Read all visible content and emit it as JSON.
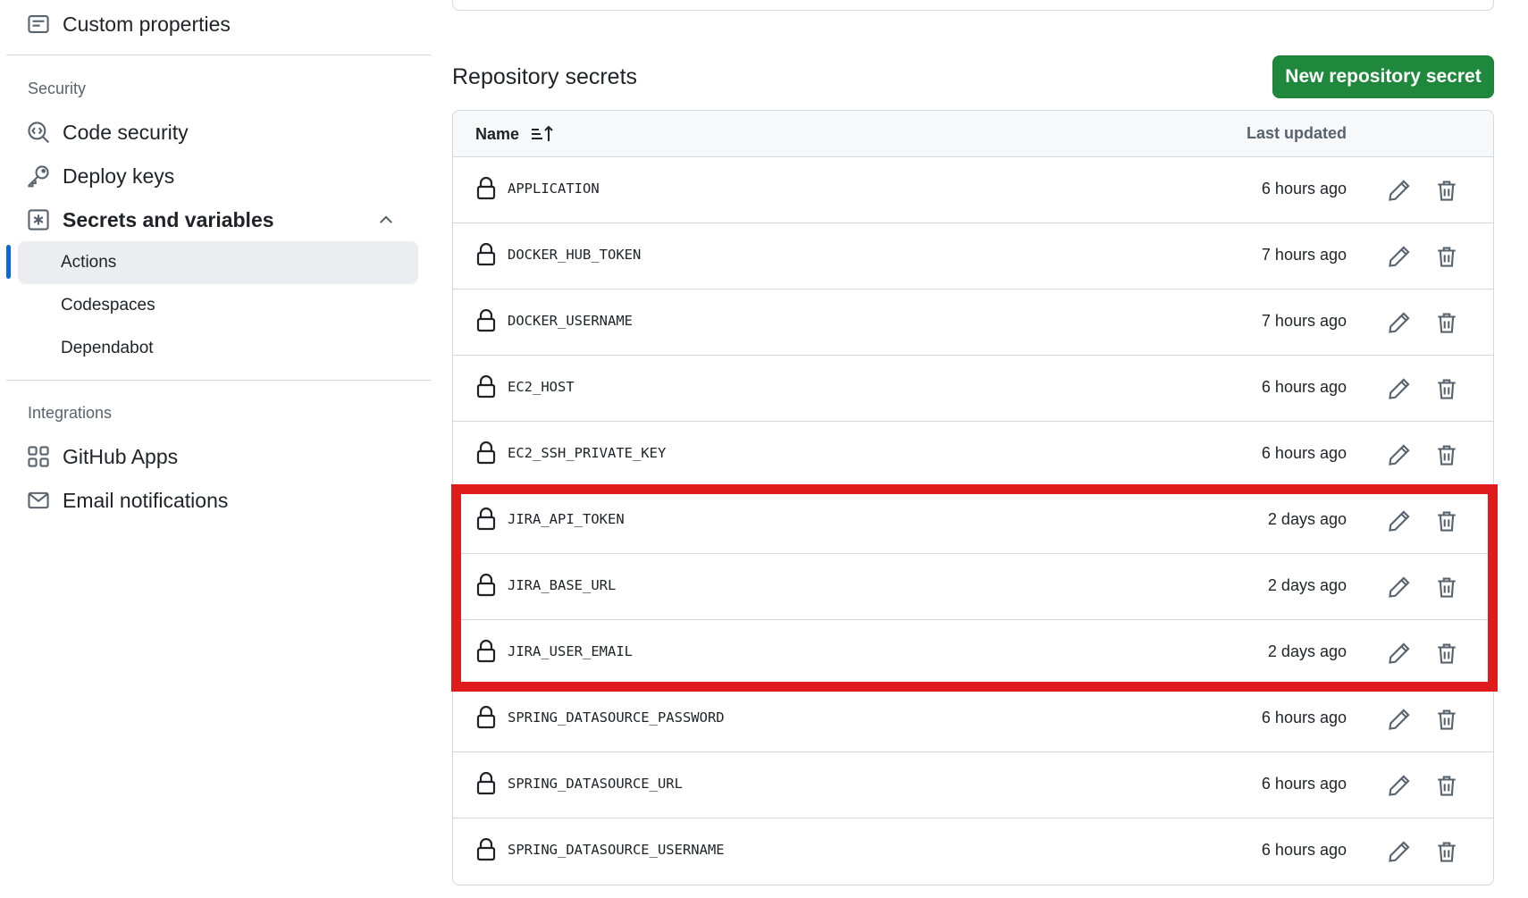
{
  "sidebar": {
    "custom_properties": "Custom properties",
    "security_heading": "Security",
    "code_security": "Code security",
    "deploy_keys": "Deploy keys",
    "secrets_and_variables": "Secrets and variables",
    "sub_items": [
      "Actions",
      "Codespaces",
      "Dependabot"
    ],
    "integrations_heading": "Integrations",
    "github_apps": "GitHub Apps",
    "email_notifications": "Email notifications",
    "active_accent": "#0969da"
  },
  "main": {
    "title": "Repository secrets",
    "new_button": "New repository secret",
    "new_button_color": "#1f883d",
    "table": {
      "col_name": "Name",
      "col_updated": "Last updated",
      "rows": [
        {
          "name": "APPLICATION",
          "updated": "6 hours ago"
        },
        {
          "name": "DOCKER_HUB_TOKEN",
          "updated": "7 hours ago"
        },
        {
          "name": "DOCKER_USERNAME",
          "updated": "7 hours ago"
        },
        {
          "name": "EC2_HOST",
          "updated": "6 hours ago"
        },
        {
          "name": "EC2_SSH_PRIVATE_KEY",
          "updated": "6 hours ago"
        },
        {
          "name": "JIRA_API_TOKEN",
          "updated": "2 days ago"
        },
        {
          "name": "JIRA_BASE_URL",
          "updated": "2 days ago"
        },
        {
          "name": "JIRA_USER_EMAIL",
          "updated": "2 days ago"
        },
        {
          "name": "SPRING_DATASOURCE_PASSWORD",
          "updated": "6 hours ago"
        },
        {
          "name": "SPRING_DATASOURCE_URL",
          "updated": "6 hours ago"
        },
        {
          "name": "SPRING_DATASOURCE_USERNAME",
          "updated": "6 hours ago"
        }
      ]
    },
    "highlight_color": "#e01b1b"
  },
  "icons": [
    "note-icon",
    "codescan-icon",
    "key-icon",
    "key-asterisk-icon",
    "chevron-up-icon",
    "apps-icon",
    "mail-icon",
    "sort-asc-icon",
    "lock-icon",
    "pencil-icon",
    "trash-icon"
  ]
}
